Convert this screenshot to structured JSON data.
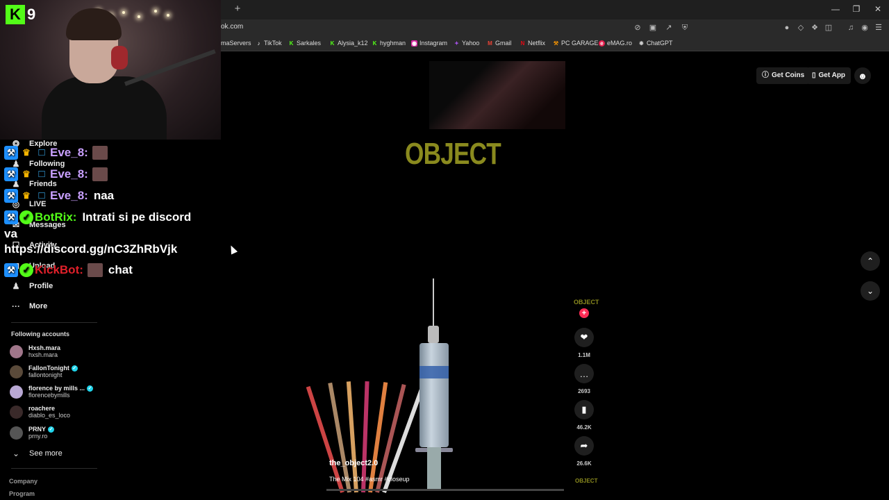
{
  "browser": {
    "url": "ok.com",
    "bookmarks": [
      {
        "label": "maServers",
        "icon": "globe-icon",
        "color": "#555555"
      },
      {
        "label": "TikTok",
        "icon": "tiktok-icon",
        "color": "#ffffff"
      },
      {
        "label": "Sarkales",
        "icon": "kick-icon",
        "color": "#53fc18"
      },
      {
        "label": "Alysia_k12",
        "icon": "kick-icon",
        "color": "#53fc18"
      },
      {
        "label": "hyghman",
        "icon": "kick-icon",
        "color": "#53fc18"
      },
      {
        "label": "Instagram",
        "icon": "instagram-icon",
        "color": "#d6249f"
      },
      {
        "label": "Yahoo",
        "icon": "yahoo-icon",
        "color": "#7b0099"
      },
      {
        "label": "Gmail",
        "icon": "gmail-icon",
        "color": "#ea4335"
      },
      {
        "label": "Netflix",
        "icon": "netflix-icon",
        "color": "#e50914"
      },
      {
        "label": "PC GARAGE",
        "icon": "pcgarage-icon",
        "color": "#ff9900"
      },
      {
        "label": "eMAG.ro",
        "icon": "emag-icon",
        "color": "#e61e4d"
      },
      {
        "label": "ChatGPT",
        "icon": "chatgpt-icon",
        "color": "#aaaaaa"
      }
    ]
  },
  "header": {
    "get_coins": "Get Coins",
    "get_app": "Get App"
  },
  "sidebar": {
    "items": [
      {
        "label": "Explore"
      },
      {
        "label": "Following"
      },
      {
        "label": "Friends"
      },
      {
        "label": "LIVE"
      },
      {
        "label": "Messages"
      },
      {
        "label": "Activity"
      },
      {
        "label": "Upload"
      },
      {
        "label": "Profile"
      },
      {
        "label": "More"
      }
    ],
    "following_title": "Following accounts",
    "accounts": [
      {
        "name": "Hxsh.mara",
        "handle": "hxsh.mara",
        "verified": false,
        "color": "#a0768a"
      },
      {
        "name": "FallonTonight",
        "handle": "fallontonight",
        "verified": true,
        "color": "#5a4a3a"
      },
      {
        "name": "florence by mills ...",
        "handle": "florencebymills",
        "verified": true,
        "color": "#b9a8d4"
      },
      {
        "name": "roachere",
        "handle": "diablo_es_loco",
        "verified": false,
        "color": "#3a2a2a"
      },
      {
        "name": "PRNY",
        "handle": "prny.ro",
        "verified": true,
        "color": "#555555"
      }
    ],
    "see_more": "See more",
    "footer": [
      "Company",
      "Program"
    ]
  },
  "stream_overlay": {
    "logo_letter": "K",
    "logo_number": "9",
    "chat": [
      {
        "user": "Eve_8:",
        "message": "",
        "user_color": "#c9a0ff",
        "emote": true
      },
      {
        "user": "Eve_8:",
        "message": "",
        "user_color": "#c9a0ff",
        "emote": true
      },
      {
        "user": "Eve_8:",
        "message": "naa",
        "user_color": "#c9a0ff",
        "emote": false
      },
      {
        "user": "BotRix:",
        "message": "Intrati si pe discord",
        "user_color": "#53fc18",
        "emote": false
      },
      {
        "user": "KickBot:",
        "message": "chat",
        "user_color": "#e0202a",
        "emote": true
      }
    ],
    "chat_wrap_1": "va",
    "chat_wrap_2": "https://discord.gg/nC3ZhRbVjk"
  },
  "video": {
    "title_overlay": "OBJECT",
    "username": "the_object2.0",
    "caption": "The Mix 104 #asmr #closeup",
    "creator_avatar_text": "OBJECT",
    "likes": "1.1M",
    "comments": "2693",
    "saves": "46.2K",
    "shares": "26.6K"
  }
}
